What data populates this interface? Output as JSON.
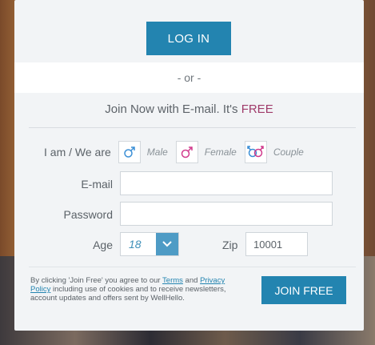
{
  "login_button": "LOG IN",
  "or_text": "- or -",
  "join": {
    "prefix": "Join Now with E-mail. It's ",
    "free": "FREE"
  },
  "gender": {
    "label": "I am / We are",
    "options": [
      "Male",
      "Female",
      "Couple"
    ]
  },
  "email": {
    "label": "E-mail",
    "value": ""
  },
  "password": {
    "label": "Password",
    "value": ""
  },
  "age": {
    "label": "Age",
    "value": "18"
  },
  "zip": {
    "label": "Zip",
    "value": "10001"
  },
  "legal": {
    "text1": "By clicking 'Join Free' you agree to our ",
    "terms": "Terms",
    "and": " and ",
    "privacy": "Privacy Policy",
    "text2": " including use of cookies and to receive newsletters, account updates and offers sent by WellHello."
  },
  "join_button": "JOIN FREE",
  "colors": {
    "primary": "#2384b0",
    "free": "#a03b6a",
    "male": "#3b8fd6",
    "female": "#d13b8d"
  }
}
